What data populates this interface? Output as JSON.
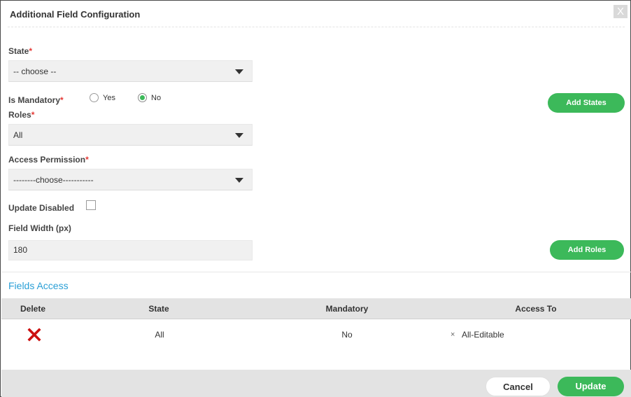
{
  "dialog": {
    "title": "Additional Field Configuration",
    "close_label": "X"
  },
  "form": {
    "state": {
      "label": "State",
      "required_mark": "*",
      "value": "-- choose --"
    },
    "is_mandatory": {
      "label": "Is Mandatory",
      "required_mark": "*",
      "options": [
        "Yes",
        "No"
      ],
      "selected": "No"
    },
    "roles": {
      "label": "Roles",
      "required_mark": "*",
      "value": "All"
    },
    "access_permission": {
      "label": "Access Permission",
      "required_mark": "*",
      "value": "--------choose-----------"
    },
    "update_disabled": {
      "label": "Update Disabled",
      "checked": false
    },
    "field_width": {
      "label": "Field Width (px)",
      "value": "180"
    },
    "add_states_label": "Add States",
    "add_roles_label": "Add Roles"
  },
  "fields_access": {
    "title": "Fields Access",
    "columns": [
      "Delete",
      "State",
      "Mandatory",
      "Access To"
    ],
    "rows": [
      {
        "state": "All",
        "mandatory": "No",
        "tag_remove": "×",
        "access_to": "All-Editable"
      }
    ]
  },
  "footer": {
    "cancel_label": "Cancel",
    "update_label": "Update"
  },
  "colors": {
    "accent_green": "#3cb95a",
    "link_blue": "#2a9fd6",
    "required_red": "#e53935",
    "delete_red": "#cc1111"
  },
  "icons": {
    "delete": "delete-x-icon",
    "dropdown": "caret-down-icon",
    "close": "close-icon"
  }
}
